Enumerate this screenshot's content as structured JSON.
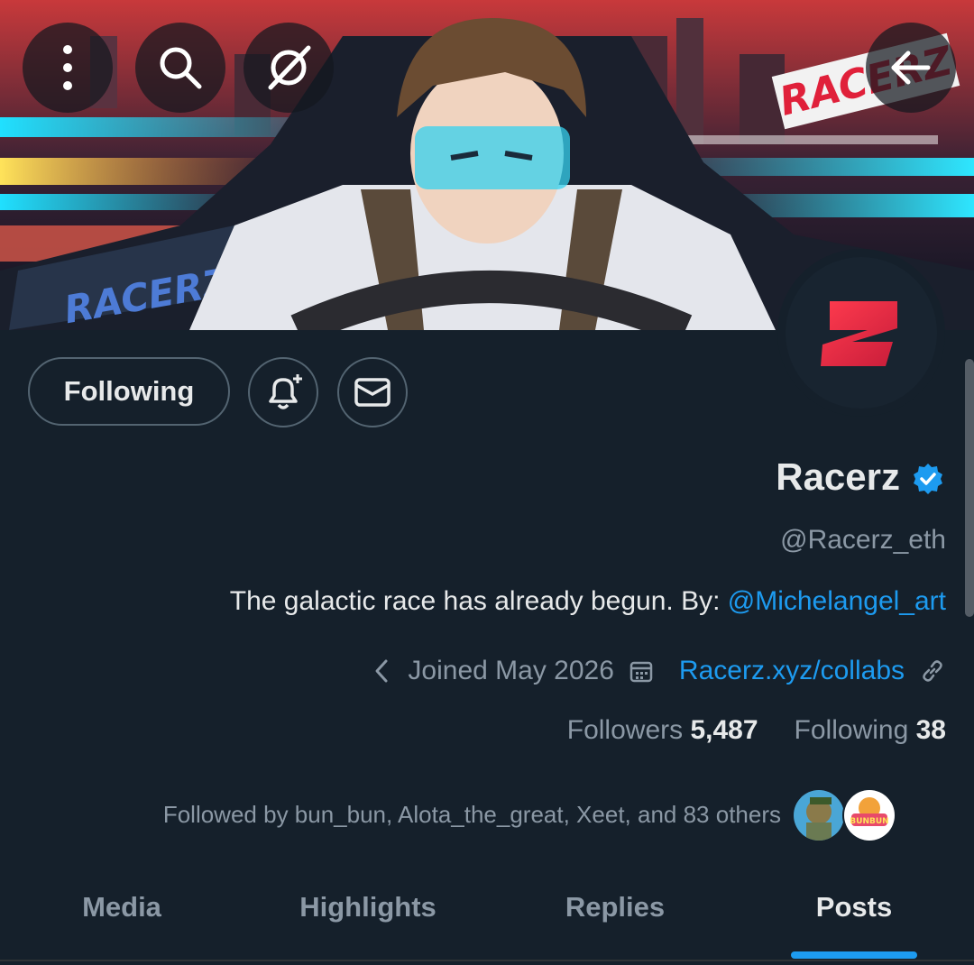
{
  "header": {
    "banner_text_top": "RACERZ",
    "banner_text_bottom": "RACERZ",
    "buttons": [
      "more",
      "search",
      "grok",
      "back"
    ]
  },
  "actions": {
    "following_label": "Following"
  },
  "profile": {
    "name": "Racerz",
    "handle": "@Racerz_eth",
    "bio_text": "The galactic race has already begun. By: ",
    "bio_mention": "@Michelangel_art",
    "joined": "Joined May 2026",
    "website": "Racerz.xyz/collabs",
    "followers_label": "Followers",
    "followers_count": "5,487",
    "following_label": "Following",
    "following_count": "38",
    "followed_by": "Followed by bun_bun, Alota_the_great, Xeet, and 83 others",
    "mini_avatar_text": "BUNBUN"
  },
  "tabs": [
    "Media",
    "Highlights",
    "Replies",
    "Posts"
  ],
  "active_tab": "Posts",
  "colors": {
    "background": "#15202b",
    "accent": "#1d9bf0",
    "muted": "#8b98a5",
    "text": "#e7e9ea"
  },
  "icons": [
    "more-vertical-icon",
    "search-icon",
    "grok-icon",
    "back-arrow-icon",
    "bell-plus-icon",
    "mail-icon",
    "verified-badge-icon",
    "chevron-left-icon",
    "calendar-icon",
    "link-icon"
  ]
}
